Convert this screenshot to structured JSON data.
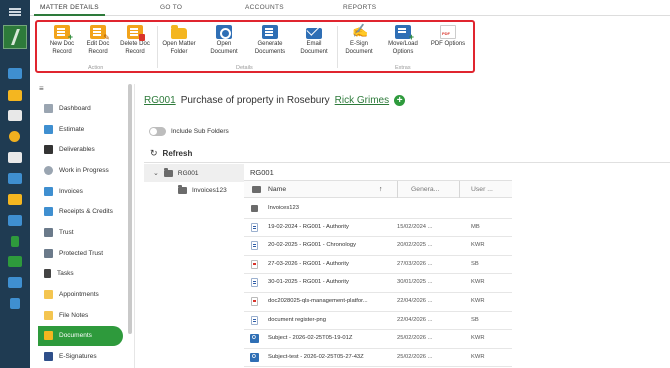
{
  "tabs": [
    "MATTER DETAILS",
    "GO TO",
    "ACCOUNTS",
    "REPORTS"
  ],
  "ribbon": {
    "buttons": [
      {
        "label": "New Doc\nRecord",
        "icon": "new-doc-record-icon"
      },
      {
        "label": "Edit Doc\nRecord",
        "icon": "edit-doc-record-icon"
      },
      {
        "label": "Delete Doc\nRecord",
        "icon": "delete-doc-record-icon"
      },
      {
        "label": "Open Matter\nFolder",
        "icon": "folder-icon"
      },
      {
        "label": "Open\nDocument",
        "icon": "open-document-icon"
      },
      {
        "label": "Generate\nDocuments",
        "icon": "generate-documents-icon"
      },
      {
        "label": "Email\nDocument",
        "icon": "email-icon"
      },
      {
        "label": "E-Sign\nDocument",
        "icon": "esign-icon"
      },
      {
        "label": "Move/Load\nOptions",
        "icon": "move-load-icon"
      },
      {
        "label": "PDF Options",
        "icon": "pdf-icon"
      }
    ],
    "groups": [
      "Action",
      "Details",
      "Extras"
    ]
  },
  "sidebar": {
    "items": [
      {
        "label": "Dashboard",
        "icon": "dashboard-icon"
      },
      {
        "label": "Estimate",
        "icon": "estimate-icon"
      },
      {
        "label": "Deliverables",
        "icon": "deliverables-icon"
      },
      {
        "label": "Work in Progress",
        "icon": "clock-icon"
      },
      {
        "label": "Invoices",
        "icon": "invoice-icon"
      },
      {
        "label": "Receipts & Credits",
        "icon": "receipts-icon"
      },
      {
        "label": "Trust",
        "icon": "trust-icon"
      },
      {
        "label": "Protected Trust",
        "icon": "protected-trust-icon"
      },
      {
        "label": "Tasks",
        "icon": "tasks-icon"
      },
      {
        "label": "Appointments",
        "icon": "calendar-icon"
      },
      {
        "label": "File Notes",
        "icon": "file-notes-icon"
      },
      {
        "label": "Documents",
        "icon": "documents-icon",
        "active": true
      },
      {
        "label": "E-Signatures",
        "icon": "esignatures-icon"
      }
    ]
  },
  "matter": {
    "code": "RG001",
    "description": "Purchase of property in Rosebury",
    "client": "Rick Grimes"
  },
  "include_sub_folders_label": "Include Sub Folders",
  "refresh_label": "Refresh",
  "tree": {
    "root": "RG001",
    "child": "Invoices123"
  },
  "grid": {
    "path": "RG001",
    "columns": {
      "name": "Name",
      "generated": "Genera...",
      "user": "User ..."
    },
    "rows": [
      {
        "type": "folder",
        "name": "Invoices123",
        "date": "",
        "user": ""
      },
      {
        "type": "doc",
        "name": "19-02-2024 - RG001 - Authority",
        "date": "15/02/2024 ...",
        "user": "MB"
      },
      {
        "type": "doc",
        "name": "20-02-2025 - RG001 - Chronology",
        "date": "20/02/2025 ...",
        "user": "KWR"
      },
      {
        "type": "pdf",
        "name": "27-03-2026 - RG001 - Authority",
        "date": "27/03/2026 ...",
        "user": "SB"
      },
      {
        "type": "doc",
        "name": "30-01-2025 - RG001 - Authority",
        "date": "30/01/2025 ...",
        "user": "KWR"
      },
      {
        "type": "pdf",
        "name": "doc2028025-qls-management-platfor...",
        "date": "22/04/2026 ...",
        "user": "KWR"
      },
      {
        "type": "doc",
        "name": "document register-png",
        "date": "22/04/2026 ...",
        "user": "SB"
      },
      {
        "type": "outlook",
        "name": "Subject - 2026-02-25T05-19-01Z",
        "date": "25/02/2026 ...",
        "user": "KWR"
      },
      {
        "type": "outlook",
        "name": "Subject-test - 2026-02-25T05-27-43Z",
        "date": "25/02/2026 ...",
        "user": "KWR"
      }
    ]
  },
  "colors": {
    "accent": "#2e9a3c",
    "rail": "#1f3b52",
    "highlight": "#e0252f"
  }
}
